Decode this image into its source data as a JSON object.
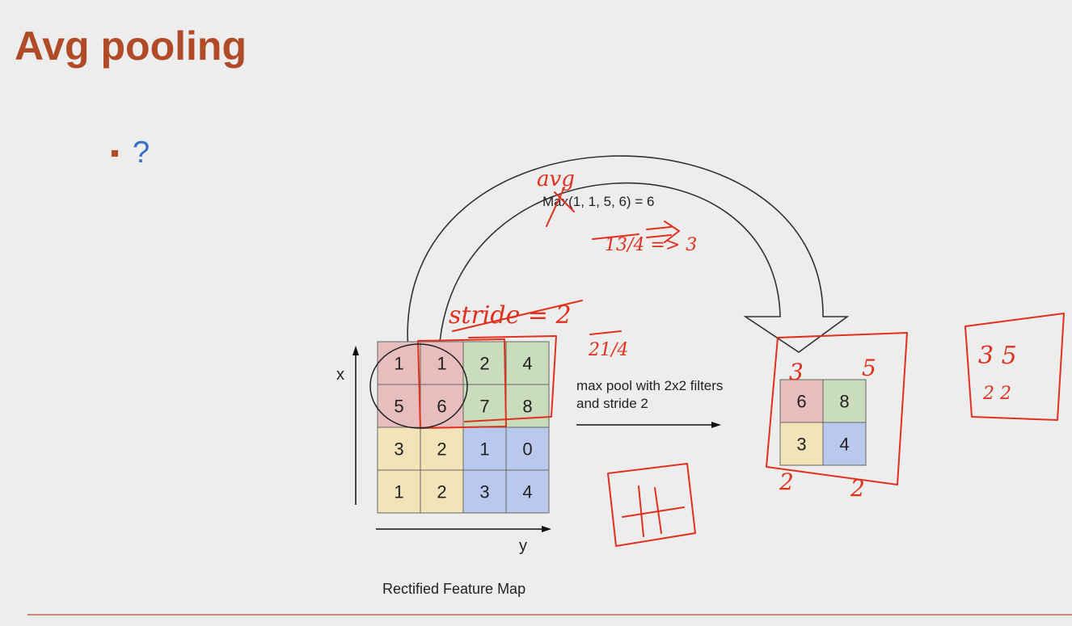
{
  "slide": {
    "title": "Avg pooling",
    "bullet": "?"
  },
  "diagram": {
    "input_grid": [
      [
        "1",
        "1",
        "2",
        "4"
      ],
      [
        "5",
        "6",
        "7",
        "8"
      ],
      [
        "3",
        "2",
        "1",
        "0"
      ],
      [
        "1",
        "2",
        "3",
        "4"
      ]
    ],
    "output_grid": [
      [
        "6",
        "8"
      ],
      [
        "3",
        "4"
      ]
    ],
    "colors": {
      "red": "#e8bdbd",
      "green": "#c9dcbc",
      "yellow": "#f3e3b8",
      "blue": "#b9c9ee",
      "ink": "#e0301e"
    },
    "axis_x": "x",
    "axis_y": "y",
    "caption": "Rectified Feature Map",
    "arrow_label_line1": "max pool with 2x2 filters",
    "arrow_label_line2": "and stride 2",
    "formula": "Max(1, 1, 5, 6) = 6"
  },
  "annotations": {
    "avg": "avg",
    "frac_13_4": "13/4 => 3",
    "stride": "stride = 2",
    "frac_21_4": "21/4",
    "out_top_left": "3",
    "out_top_right": "5",
    "out_bottom_left": "2",
    "out_bottom_right": "2",
    "right_box_row1": "3  5",
    "right_box_row2": "2  2"
  }
}
